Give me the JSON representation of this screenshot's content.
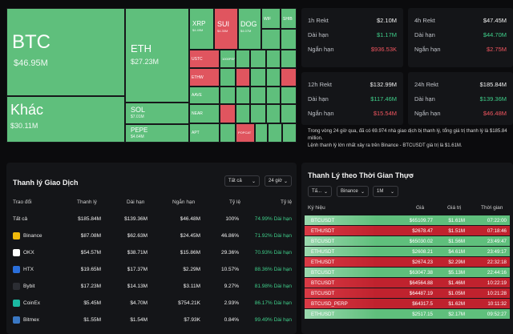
{
  "treemap": {
    "tiles": [
      {
        "name": "BTC",
        "value": "$46.95M",
        "color": "g"
      },
      {
        "name": "Khác",
        "value": "$30.11M",
        "color": "g"
      },
      {
        "name": "ETH",
        "value": "$27.23M",
        "color": "g"
      },
      {
        "name": "SOL",
        "value": "$7.01M",
        "color": "g"
      },
      {
        "name": "PEPE",
        "value": "$4.64M",
        "color": "g"
      },
      {
        "name": "XRP",
        "value": "$4.49M",
        "color": "g"
      },
      {
        "name": "SUI",
        "value": "$4.30M",
        "color": "r"
      },
      {
        "name": "DOG",
        "value": "$4.07M",
        "color": "g"
      },
      {
        "name": "WIF",
        "value": "",
        "color": "g"
      },
      {
        "name": "SHIB",
        "value": "",
        "color": "g"
      },
      {
        "name": "USTC",
        "value": "",
        "color": "r"
      },
      {
        "name": "1000PEPE",
        "value": "",
        "color": "g"
      },
      {
        "name": "ETHW",
        "value": "",
        "color": "r"
      },
      {
        "name": "AAVE",
        "value": "",
        "color": "g"
      },
      {
        "name": "NEAR",
        "value": "",
        "color": "g"
      },
      {
        "name": "APT",
        "value": "",
        "color": "g"
      },
      {
        "name": "POPCAT",
        "value": "",
        "color": "r"
      }
    ]
  },
  "stats": [
    {
      "title": "1h Rekt",
      "total": "$2.10M",
      "long_label": "Dài hạn",
      "long": "$1.17M",
      "short_label": "Ngắn hạn",
      "short": "$936.53K"
    },
    {
      "title": "4h Rekt",
      "total": "$47.45M",
      "long_label": "Dài hạn",
      "long": "$44.70M",
      "short_label": "Ngắn hạn",
      "short": "$2.75M"
    },
    {
      "title": "12h Rekt",
      "total": "$132.99M",
      "long_label": "Dài hạn",
      "long": "$117.46M",
      "short_label": "Ngắn hạn",
      "short": "$15.54M"
    },
    {
      "title": "24h Rekt",
      "total": "$185.84M",
      "long_label": "Dài hạn",
      "long": "$139.36M",
      "short_label": "Ngắn hạn",
      "short": "$46.48M"
    }
  ],
  "summary": {
    "line1": "Trong vòng 24 giờ qua, đã có 69.974 nhà giao dịch bị thanh lý, tổng giá trị thanh lý là $185.84 million.",
    "line2": "Lệnh thanh lý lớn nhất xảy ra trên Binance - BTCUSDT giá trị là $1.61M."
  },
  "exchange_panel": {
    "title": "Thanh lý Giao Dịch",
    "filter_coin": "Tất cả",
    "filter_time": "24 giờ",
    "headers": [
      "Trao đổi",
      "Thanh lý",
      "Dài hạn",
      "Ngắn hạn",
      "Tỷ lệ",
      "Tỷ lệ"
    ],
    "rows": [
      {
        "name": "Tất cả",
        "icon": "",
        "total": "$185.84M",
        "long": "$139.36M",
        "short": "$46.48M",
        "pct": "100%",
        "ratio": "74.99% Dài hạn"
      },
      {
        "name": "Binance",
        "icon": "binance-icon",
        "total": "$87.08M",
        "long": "$62.63M",
        "short": "$24.45M",
        "pct": "46.86%",
        "ratio": "71.92% Dài hạn"
      },
      {
        "name": "OKX",
        "icon": "okx-icon",
        "total": "$54.57M",
        "long": "$38.71M",
        "short": "$15.86M",
        "pct": "29.36%",
        "ratio": "70.93% Dài hạn"
      },
      {
        "name": "HTX",
        "icon": "htx-icon",
        "total": "$19.65M",
        "long": "$17.37M",
        "short": "$2.29M",
        "pct": "10.57%",
        "ratio": "88.36% Dài hạn"
      },
      {
        "name": "Bybit",
        "icon": "bybit-icon",
        "total": "$17.23M",
        "long": "$14.13M",
        "short": "$3.11M",
        "pct": "9.27%",
        "ratio": "81.98% Dài hạn"
      },
      {
        "name": "CoinEx",
        "icon": "coinex-icon",
        "total": "$5.45M",
        "long": "$4.70M",
        "short": "$754.21K",
        "pct": "2.93%",
        "ratio": "86.17% Dài hạn"
      },
      {
        "name": "Bitmex",
        "icon": "bitmex-icon",
        "total": "$1.55M",
        "long": "$1.54M",
        "short": "$7.93K",
        "pct": "0.84%",
        "ratio": "99.49% Dài hạn"
      }
    ]
  },
  "realtime_panel": {
    "title": "Thanh Lý theo Thời Gian Thực",
    "filter_coin": "Tấ...",
    "filter_exchange": "Binance",
    "filter_amount": "1M",
    "headers": [
      "Ký hiệu",
      "Giá",
      "Giá trị",
      "Thời gian"
    ],
    "rows": [
      {
        "symbol": "BTCUSDT",
        "price": "$65109.77",
        "value": "$1.61M",
        "time": "07:22:00",
        "side": "long"
      },
      {
        "symbol": "ETHUSDT",
        "price": "$2678.47",
        "value": "$1.51M",
        "time": "07:18:46",
        "side": "short"
      },
      {
        "symbol": "BTCUSDT",
        "price": "$65030.02",
        "value": "$1.56M",
        "time": "23:49:47",
        "side": "long"
      },
      {
        "symbol": "ETHUSDT",
        "price": "$2608.21",
        "value": "$4.61M",
        "time": "23:49:17",
        "side": "long"
      },
      {
        "symbol": "ETHUSDT",
        "price": "$2674.23",
        "value": "$2.29M",
        "time": "22:32:18",
        "side": "short"
      },
      {
        "symbol": "BTCUSDT",
        "price": "$63047.38",
        "value": "$5.13M",
        "time": "22:44:16",
        "side": "long"
      },
      {
        "symbol": "BTCUSDT",
        "price": "$64564.88",
        "value": "$1.46M",
        "time": "10:22:19",
        "side": "short"
      },
      {
        "symbol": "BTCUSDT",
        "price": "$64487.19",
        "value": "$1.05M",
        "time": "10:21:28",
        "side": "short"
      },
      {
        "symbol": "BTCUSD_PERP",
        "price": "$64317.5",
        "value": "$1.62M",
        "time": "10:11:32",
        "side": "short"
      },
      {
        "symbol": "ETHUSDT",
        "price": "$2517.15",
        "value": "$2.17M",
        "time": "09:52:27",
        "side": "long"
      }
    ]
  },
  "colors": {
    "long_green": "#5fbf7c",
    "short_red": "#e0555f",
    "text_green": "#3fcf8a",
    "text_red": "#f0555f"
  }
}
